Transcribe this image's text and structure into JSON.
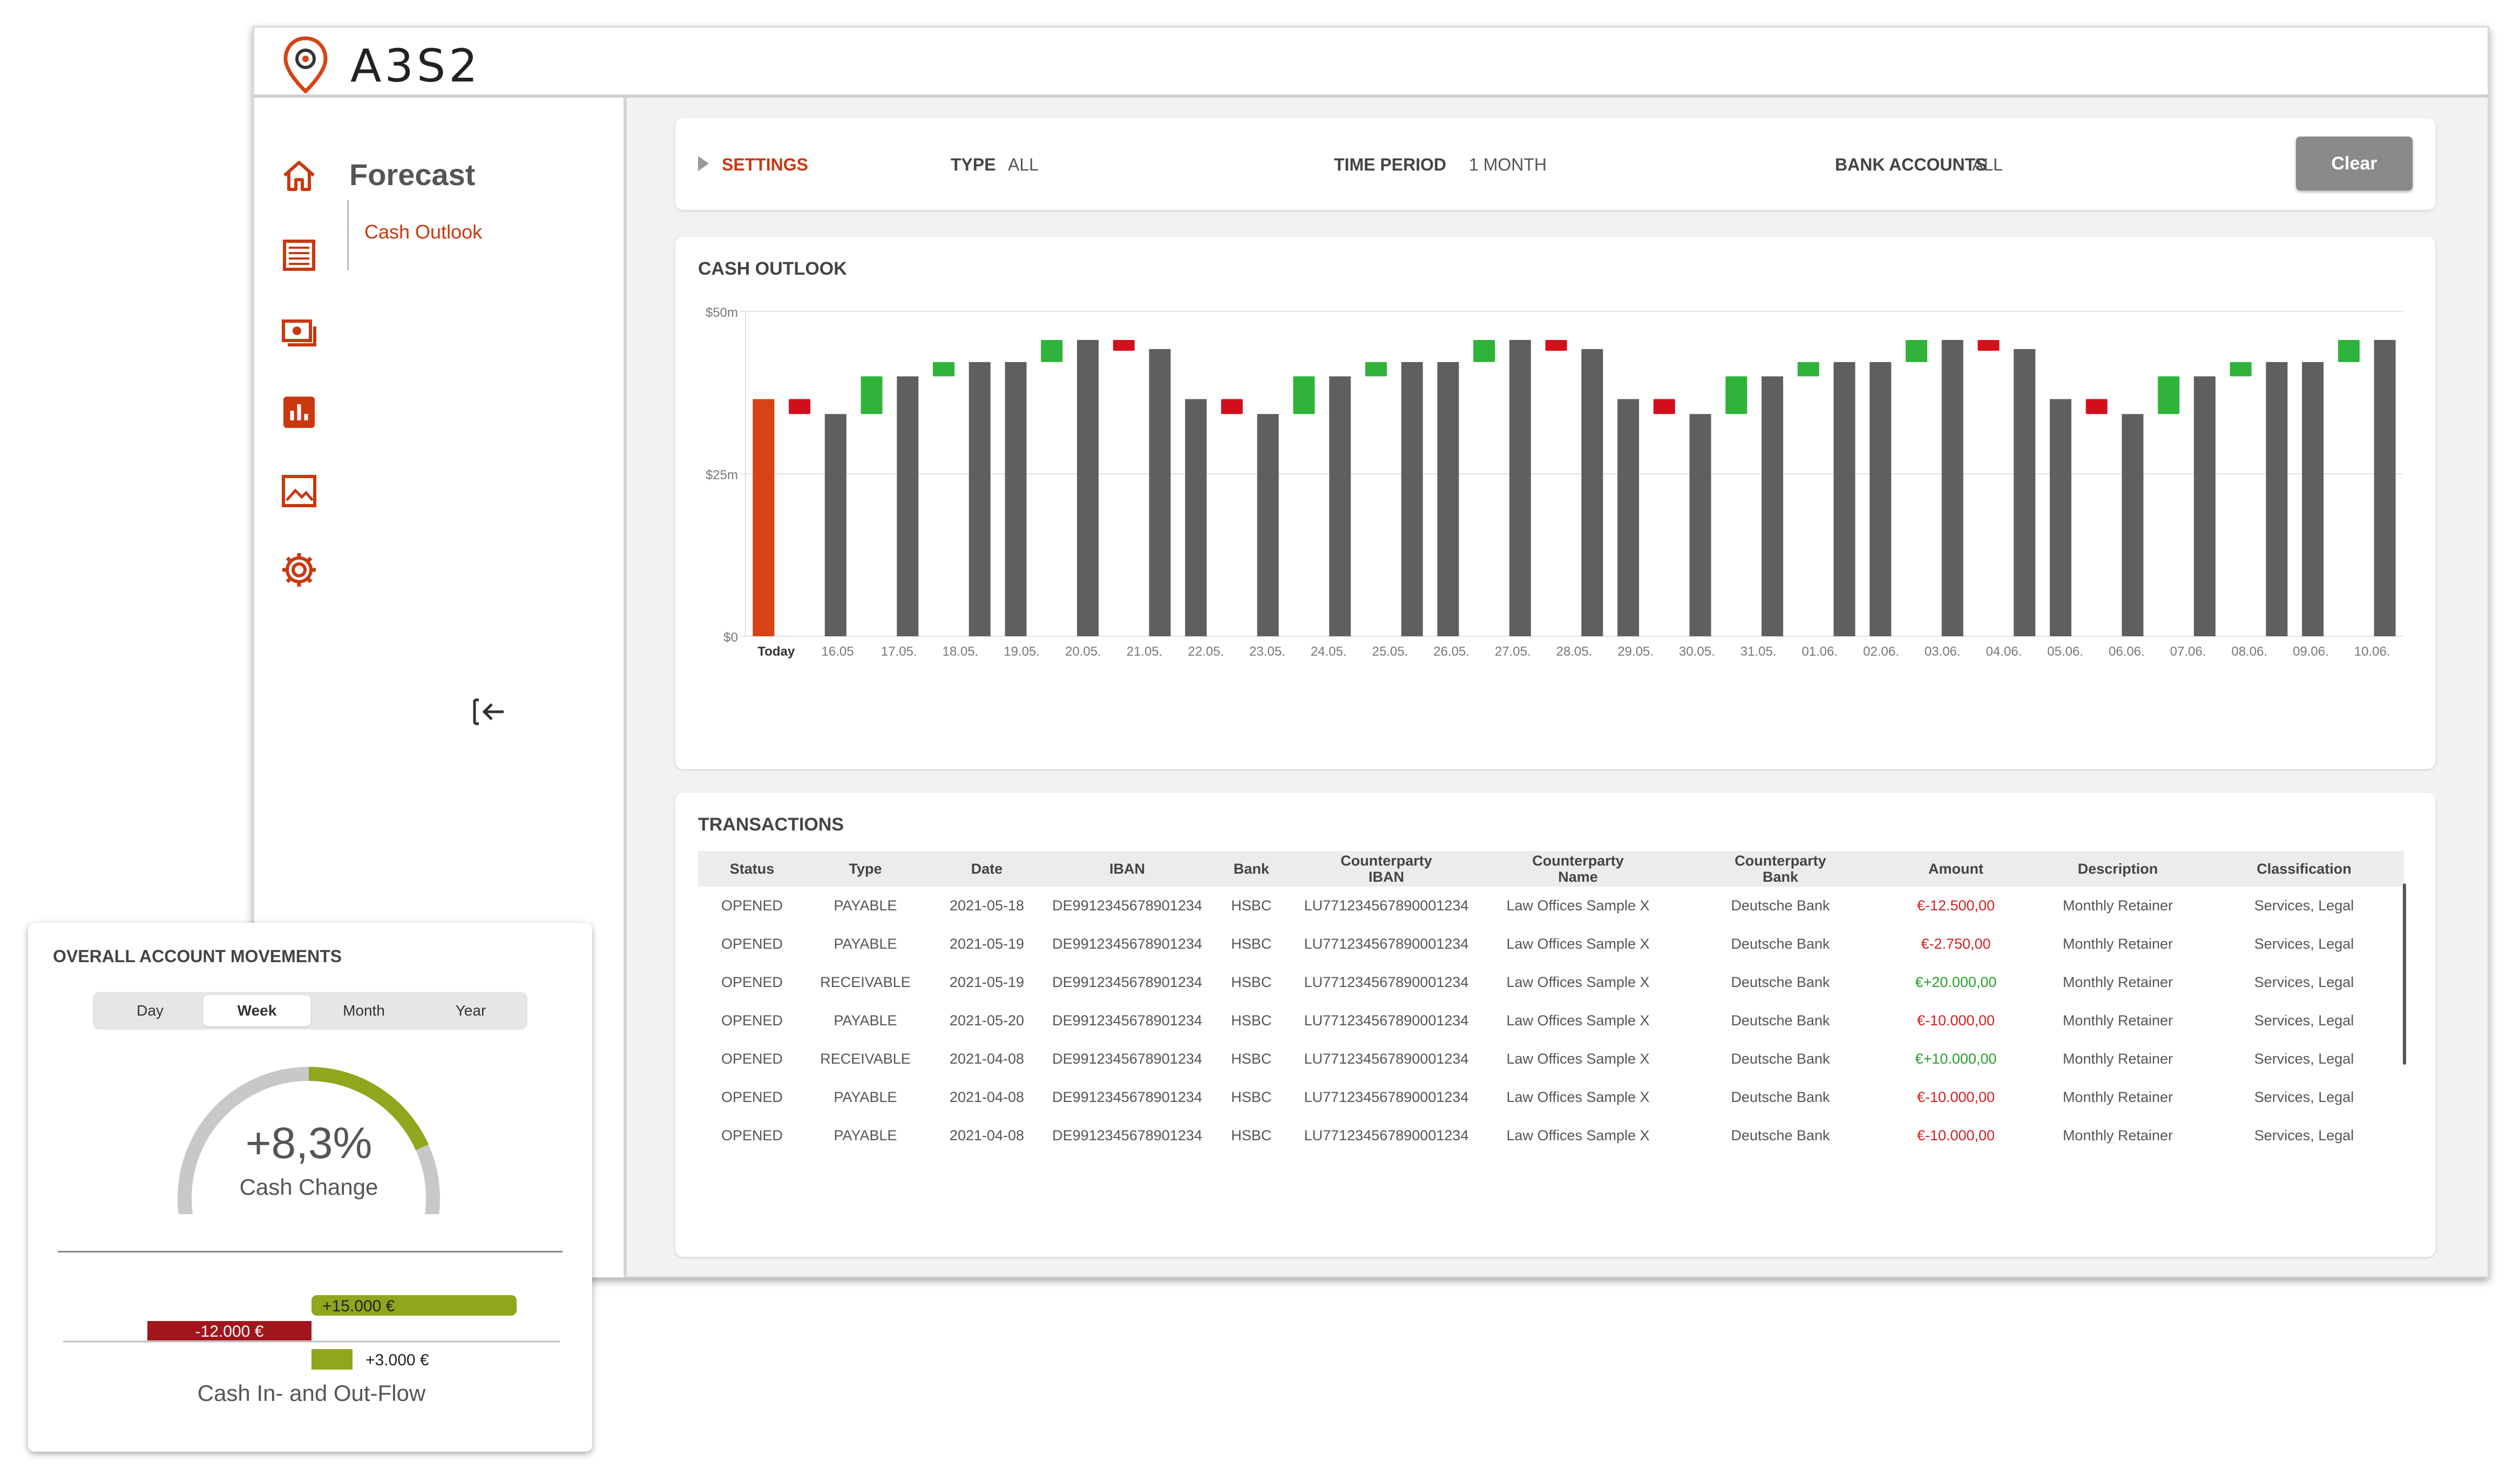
{
  "app": {
    "logo_text": "A3S2"
  },
  "sidebar": {
    "section_title": "Forecast",
    "sub_item": "Cash Outlook",
    "nav_icons": [
      "home-icon",
      "list-icon",
      "money-icon",
      "bar-chart-icon",
      "image-icon",
      "gear-icon"
    ]
  },
  "settings": {
    "title": "SETTINGS",
    "type_label": "TYPE",
    "type_value": "ALL",
    "period_label": "TIME PERIOD",
    "period_value": "1 MONTH",
    "accounts_label": "BANK ACCOUNTS",
    "accounts_value": "ALL",
    "clear_label": "Clear"
  },
  "colors": {
    "accent": "#c9380f",
    "bar_gray": "#5f5f5f",
    "today_bar": "#d84315",
    "increase": "#2fb33a",
    "decrease": "#d40f1c",
    "gauge_fill": "#8fa71c",
    "flow_in": "#8fa71c",
    "flow_out": "#a3151c"
  },
  "cash_outlook": {
    "title": "CASH OUTLOOK",
    "chart_data": {
      "type": "bar",
      "title": "CASH OUTLOOK",
      "ylim": [
        0,
        50
      ],
      "y_ticks": [
        "$0",
        "$25m",
        "$50m"
      ],
      "x_ticks": [
        "Today",
        "16.05",
        "17.05.",
        "18.05.",
        "19.05.",
        "20.05.",
        "21.05.",
        "22.05.",
        "23.05.",
        "24.05.",
        "25.05.",
        "26.05.",
        "27.05.",
        "28.05.",
        "29.05.",
        "30.05.",
        "31.05.",
        "01.06.",
        "02.06.",
        "03.06.",
        "04.06.",
        "05.06.",
        "06.06.",
        "07.06.",
        "08.06.",
        "09.06.",
        "10.06."
      ],
      "bars": [
        {
          "kind": "today",
          "value": 36.5
        },
        {
          "kind": "dec",
          "from": 36.5,
          "to": 34.2
        },
        {
          "kind": "bar",
          "value": 34.2
        },
        {
          "kind": "inc",
          "from": 34.2,
          "to": 40
        },
        {
          "kind": "bar",
          "value": 40
        },
        {
          "kind": "inc",
          "from": 40,
          "to": 42.2
        },
        {
          "kind": "bar",
          "value": 42.2
        },
        {
          "kind": "bar",
          "value": 42.2
        },
        {
          "kind": "inc",
          "from": 42.2,
          "to": 45.6
        },
        {
          "kind": "bar",
          "value": 45.6
        },
        {
          "kind": "dec",
          "from": 45.6,
          "to": 44.2
        },
        {
          "kind": "bar",
          "value": 44.2
        },
        {
          "kind": "bar",
          "value": 36.5
        },
        {
          "kind": "dec",
          "from": 36.5,
          "to": 34.2
        },
        {
          "kind": "bar",
          "value": 34.2
        },
        {
          "kind": "inc",
          "from": 34.2,
          "to": 40
        },
        {
          "kind": "bar",
          "value": 40
        },
        {
          "kind": "inc",
          "from": 40,
          "to": 42.2
        },
        {
          "kind": "bar",
          "value": 42.2
        },
        {
          "kind": "bar",
          "value": 42.2
        },
        {
          "kind": "inc",
          "from": 42.2,
          "to": 45.6
        },
        {
          "kind": "bar",
          "value": 45.6
        },
        {
          "kind": "dec",
          "from": 45.6,
          "to": 44.2
        },
        {
          "kind": "bar",
          "value": 44.2
        },
        {
          "kind": "bar",
          "value": 36.5
        },
        {
          "kind": "dec",
          "from": 36.5,
          "to": 34.2
        },
        {
          "kind": "bar",
          "value": 34.2
        },
        {
          "kind": "inc",
          "from": 34.2,
          "to": 40
        },
        {
          "kind": "bar",
          "value": 40
        },
        {
          "kind": "inc",
          "from": 40,
          "to": 42.2
        },
        {
          "kind": "bar",
          "value": 42.2
        },
        {
          "kind": "bar",
          "value": 42.2
        },
        {
          "kind": "inc",
          "from": 42.2,
          "to": 45.6
        },
        {
          "kind": "bar",
          "value": 45.6
        },
        {
          "kind": "dec",
          "from": 45.6,
          "to": 44.2
        },
        {
          "kind": "bar",
          "value": 44.2
        },
        {
          "kind": "bar",
          "value": 36.5
        },
        {
          "kind": "dec",
          "from": 36.5,
          "to": 34.2
        },
        {
          "kind": "bar",
          "value": 34.2
        },
        {
          "kind": "inc",
          "from": 34.2,
          "to": 40
        },
        {
          "kind": "bar",
          "value": 40
        },
        {
          "kind": "inc",
          "from": 40,
          "to": 42.2
        },
        {
          "kind": "bar",
          "value": 42.2
        },
        {
          "kind": "bar",
          "value": 42.2
        },
        {
          "kind": "inc",
          "from": 42.2,
          "to": 45.6
        },
        {
          "kind": "bar",
          "value": 45.6
        }
      ]
    }
  },
  "transactions": {
    "title": "TRANSACTIONS",
    "headers": [
      "Status",
      "Type",
      "Date",
      "IBAN",
      "Bank",
      "Counterparty\nIBAN",
      "Counterparty\nName",
      "Counterparty\nBank",
      "Amount",
      "Description",
      "Classification"
    ],
    "rows": [
      [
        "OPENED",
        "PAYABLE",
        "2021-05-18",
        "DE9912345678901234",
        "HSBC",
        "LU771234567890001234",
        "Law Offices Sample X",
        "Deutsche Bank",
        "€-12.500,00",
        "Monthly Retainer",
        "Services, Legal"
      ],
      [
        "OPENED",
        "PAYABLE",
        "2021-05-19",
        "DE9912345678901234",
        "HSBC",
        "LU771234567890001234",
        "Law Offices Sample X",
        "Deutsche Bank",
        "€-2.750,00",
        "Monthly Retainer",
        "Services, Legal"
      ],
      [
        "OPENED",
        "RECEIVABLE",
        "2021-05-19",
        "DE9912345678901234",
        "HSBC",
        "LU771234567890001234",
        "Law Offices Sample X",
        "Deutsche Bank",
        "€+20.000,00",
        "Monthly Retainer",
        "Services, Legal"
      ],
      [
        "OPENED",
        "PAYABLE",
        "2021-05-20",
        "DE9912345678901234",
        "HSBC",
        "LU771234567890001234",
        "Law Offices Sample X",
        "Deutsche Bank",
        "€-10.000,00",
        "Monthly Retainer",
        "Services, Legal"
      ],
      [
        "OPENED",
        "RECEIVABLE",
        "2021-04-08",
        "DE9912345678901234",
        "HSBC",
        "LU771234567890001234",
        "Law Offices Sample X",
        "Deutsche Bank",
        "€+10.000,00",
        "Monthly Retainer",
        "Services, Legal"
      ],
      [
        "OPENED",
        "PAYABLE",
        "2021-04-08",
        "DE9912345678901234",
        "HSBC",
        "LU771234567890001234",
        "Law Offices Sample X",
        "Deutsche Bank",
        "€-10.000,00",
        "Monthly Retainer",
        "Services, Legal"
      ],
      [
        "OPENED",
        "PAYABLE",
        "2021-04-08",
        "DE9912345678901234",
        "HSBC",
        "LU771234567890001234",
        "Law Offices Sample X",
        "Deutsche Bank",
        "€-10.000,00",
        "Monthly Retainer",
        "Services, Legal"
      ]
    ]
  },
  "movements": {
    "title": "OVERALL ACCOUNT MOVEMENTS",
    "periods": [
      "Day",
      "Week",
      "Month",
      "Year"
    ],
    "active_period": "Week",
    "gauge_value": "+8,3%",
    "gauge_label": "Cash Change",
    "gauge_fill_fraction": 0.3,
    "flow_label": "Cash In- and Out-Flow",
    "flows": [
      {
        "label": "+15.000 €",
        "value": 15000,
        "direction": "in"
      },
      {
        "label": "-12.000 €",
        "value": -12000,
        "direction": "out"
      },
      {
        "label": "+3.000 €",
        "value": 3000,
        "direction": "in"
      }
    ]
  }
}
